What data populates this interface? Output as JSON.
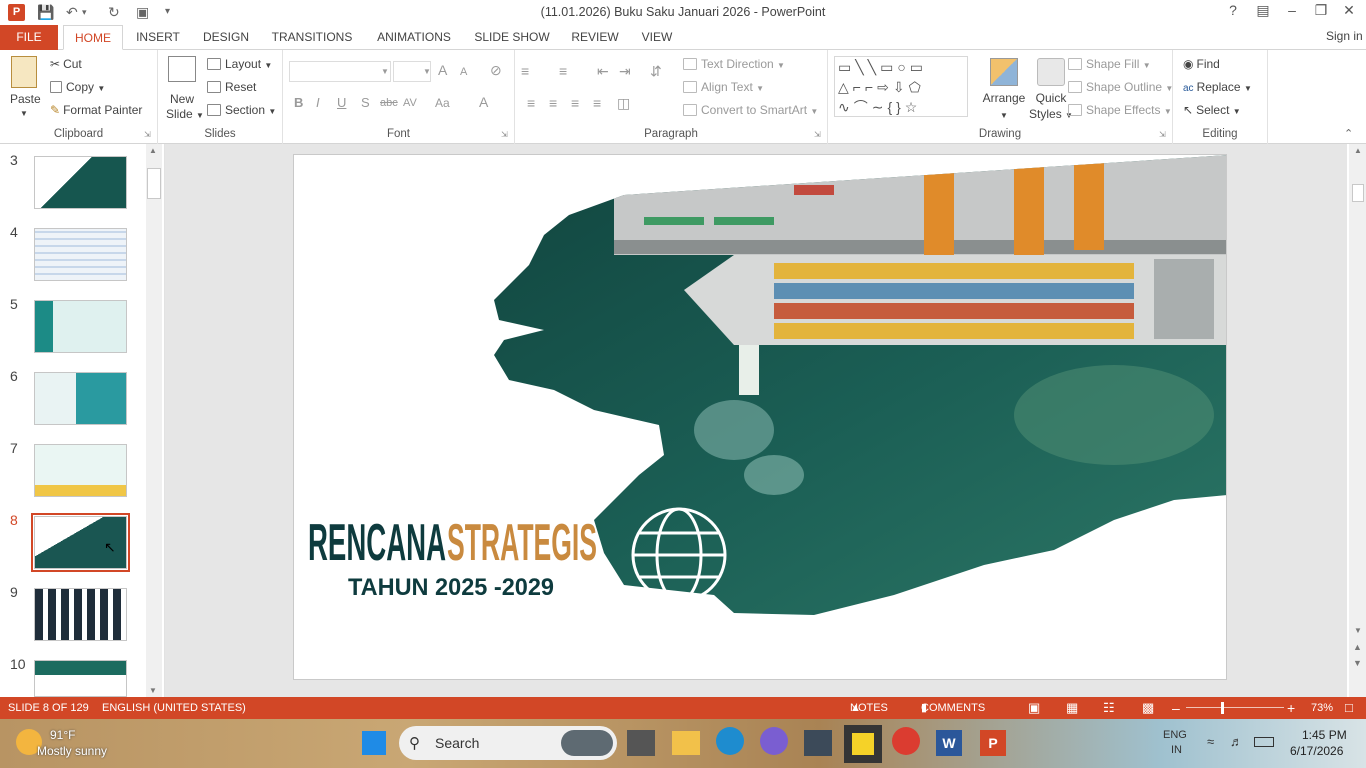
{
  "app": {
    "title": "(11.01.2026) Buku Saku Januari 2026 - PowerPoint",
    "sign_in": "Sign in"
  },
  "tabs": [
    "FILE",
    "HOME",
    "INSERT",
    "DESIGN",
    "TRANSITIONS",
    "ANIMATIONS",
    "SLIDE SHOW",
    "REVIEW",
    "VIEW"
  ],
  "active_tab": "HOME",
  "ribbon": {
    "clipboard": {
      "label": "Clipboard",
      "paste": "Paste",
      "cut": "Cut",
      "copy": "Copy",
      "format_painter": "Format Painter"
    },
    "slides": {
      "label": "Slides",
      "new_slide_1": "New",
      "new_slide_2": "Slide",
      "layout": "Layout",
      "reset": "Reset",
      "section": "Section"
    },
    "font": {
      "label": "Font",
      "bold": "B",
      "italic": "I",
      "underline": "U",
      "shadow": "S",
      "strike": "abc",
      "spacing": "AV",
      "case": "Aa",
      "color": "A",
      "grow": "A",
      "shrink": "A"
    },
    "paragraph": {
      "label": "Paragraph",
      "text_direction": "Text Direction",
      "align_text": "Align Text",
      "convert_smartart": "Convert to SmartArt"
    },
    "drawing": {
      "label": "Drawing",
      "arrange": "Arrange",
      "quick_styles_1": "Quick",
      "quick_styles_2": "Styles",
      "shape_fill": "Shape Fill",
      "shape_outline": "Shape Outline",
      "shape_effects": "Shape Effects"
    },
    "editing": {
      "label": "Editing",
      "find": "Find",
      "replace": "Replace",
      "select": "Select"
    }
  },
  "thumbnails": [
    {
      "num": "3"
    },
    {
      "num": "4"
    },
    {
      "num": "5"
    },
    {
      "num": "6"
    },
    {
      "num": "7"
    },
    {
      "num": "8",
      "selected": true
    },
    {
      "num": "9"
    },
    {
      "num": "10"
    }
  ],
  "slide": {
    "title_part1": "RENCANA",
    "title_part2": "STRATEGIS",
    "subtitle": "TAHUN 2025 -2029"
  },
  "status": {
    "slide_info": "SLIDE 8 OF 129",
    "language": "ENGLISH (UNITED STATES)",
    "notes": "NOTES",
    "comments": "COMMENTS",
    "zoom": "73%",
    "zoom_level": 0.73
  },
  "taskbar": {
    "weather_temp": "91°F",
    "weather_desc": "Mostly sunny",
    "search": "Search",
    "lang_1": "ENG",
    "lang_2": "IN",
    "time": "1:45 PM",
    "date": "6/17/2026"
  },
  "colors": {
    "accent": "#d24726",
    "slide_title_dark": "#0e3b3e",
    "slide_title_gold": "#c98a3f"
  }
}
